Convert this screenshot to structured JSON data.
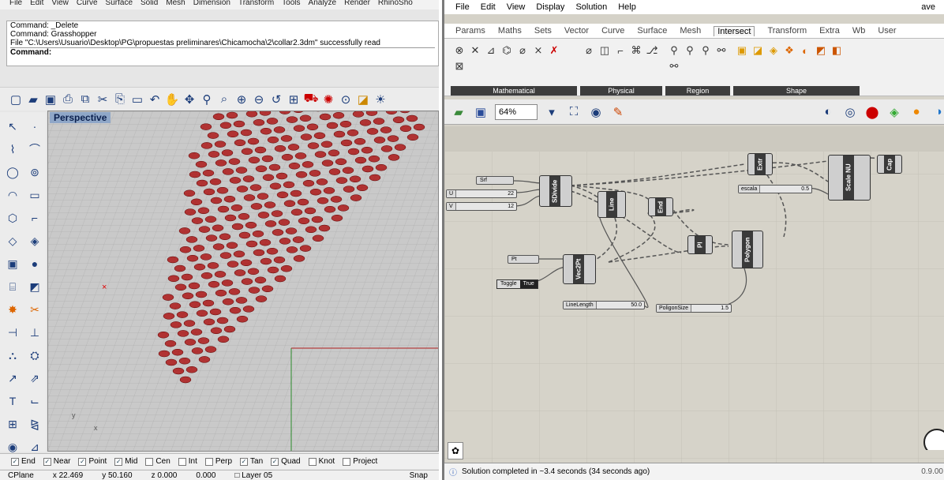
{
  "rhino": {
    "menu": [
      "File",
      "Edit",
      "View",
      "Curve",
      "Surface",
      "Solid",
      "Mesh",
      "Dimension",
      "Transform",
      "Tools",
      "Analyze",
      "Render",
      "RhinoSho"
    ],
    "command_history": [
      "Command: _Delete",
      "Command: Grasshopper",
      "File \"C:\\Users\\Usuario\\Desktop\\PG\\propuestas preliminares\\Chicamocha\\2\\collar2.3dm\" successfully read"
    ],
    "command_prompt": "Command:",
    "viewport_label": "Perspective",
    "axis_y": "y",
    "axis_x": "x",
    "osnaps": [
      {
        "label": "End",
        "checked": true
      },
      {
        "label": "Near",
        "checked": true
      },
      {
        "label": "Point",
        "checked": true
      },
      {
        "label": "Mid",
        "checked": true
      },
      {
        "label": "Cen",
        "checked": false
      },
      {
        "label": "Int",
        "checked": false
      },
      {
        "label": "Perp",
        "checked": false
      },
      {
        "label": "Tan",
        "checked": true
      },
      {
        "label": "Quad",
        "checked": true
      },
      {
        "label": "Knot",
        "checked": false
      },
      {
        "label": "Project",
        "checked": false
      }
    ],
    "status": {
      "cplane": "CPlane",
      "x": "x 22.469",
      "y": "y 50.160",
      "z": "z 0.000",
      "dist": "0.000",
      "layer": "Layer 05",
      "snap": "Snap"
    },
    "geometry_color": "#a80000"
  },
  "grasshopper": {
    "menu": [
      "File",
      "Edit",
      "View",
      "Display",
      "Solution",
      "Help"
    ],
    "menu_right": "ave",
    "tabs": [
      "Params",
      "Maths",
      "Sets",
      "Vector",
      "Curve",
      "Surface",
      "Mesh",
      "Intersect",
      "Transform",
      "Extra",
      "Wb",
      "User"
    ],
    "active_tab": "Intersect",
    "ribbon_groups": [
      "Mathematical",
      "Physical",
      "Region",
      "Shape"
    ],
    "zoom": "64%",
    "status_text": "Solution completed in ~3.4 seconds (34 seconds ago)",
    "version": "0.9.00",
    "canvas": {
      "params": {
        "srf": "Srf",
        "pt": "Pt"
      },
      "sliders": {
        "u_name": "U",
        "u_value": "22",
        "v_name": "V",
        "v_value": "12",
        "escala_name": "escala",
        "escala_value": "0.5",
        "linelength_name": "LineLength",
        "linelength_value": "50.0",
        "polygonsize_name": "PoligonSize",
        "polygonsize_value": "1.5"
      },
      "toggle": {
        "label": "Toggle",
        "value": "True"
      },
      "components": {
        "sdivide": "SDivide",
        "line": "Line",
        "end": "End",
        "vec2pt": "Vec2Pt",
        "pl": "Pl",
        "polygon": "Polygon",
        "extr": "Extr",
        "scalenu": "Scale NU",
        "cap": "Cap"
      }
    }
  }
}
